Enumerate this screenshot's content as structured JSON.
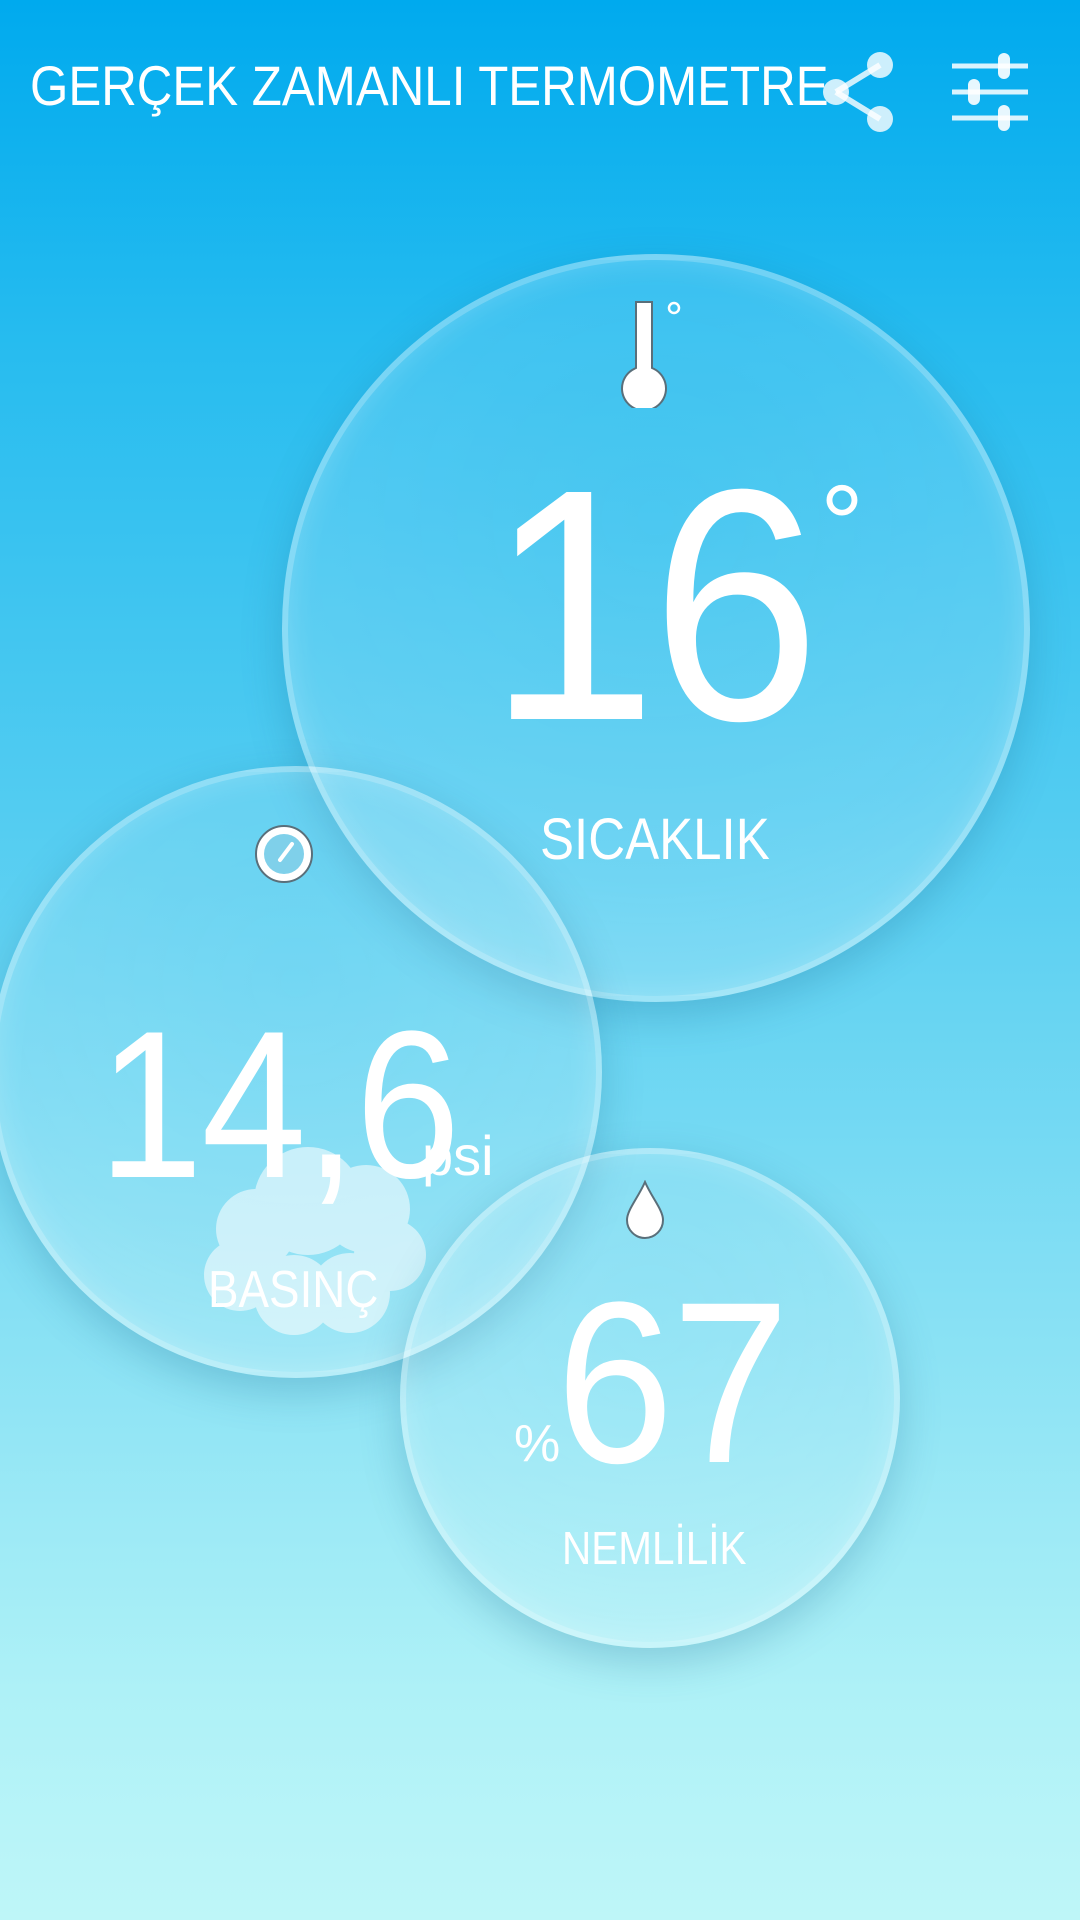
{
  "app_bar": {
    "title": "GERÇEK ZAMANLI TERMOMETRE",
    "share_icon": "share-icon",
    "settings_icon": "sliders-icon"
  },
  "temperature": {
    "value": "16",
    "degree_symbol": "°",
    "label": "SICAKLIK",
    "icon": "thermometer-icon"
  },
  "pressure": {
    "value": "14,6",
    "unit": "psi",
    "label": "BASINÇ",
    "icon": "gauge-icon",
    "weather_icon": "cloud-icon"
  },
  "humidity": {
    "prefix": "%",
    "value": "67",
    "label": "NEMLİLİK",
    "icon": "water-drop-icon"
  },
  "colors": {
    "background_top": "#00aaee",
    "background_bottom": "#bef6f8",
    "text": "#ffffff"
  }
}
